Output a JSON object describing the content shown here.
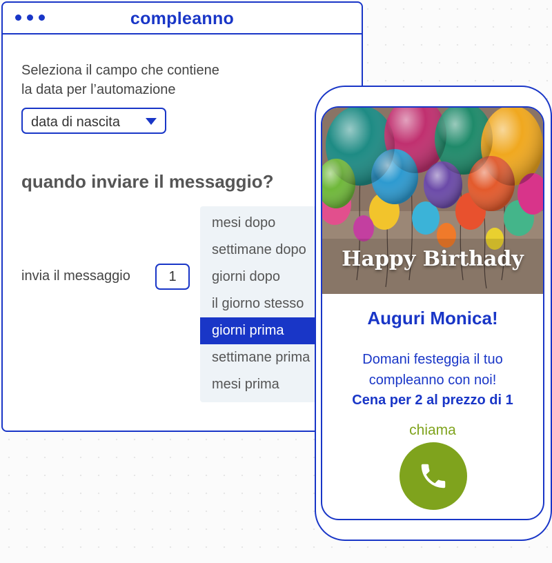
{
  "window": {
    "title": "compleanno",
    "dots": [
      "dot",
      "dot",
      "dot"
    ]
  },
  "form": {
    "instruction_line1": "Seleziona il campo che contiene",
    "instruction_line2": "la data per l’automazione",
    "field_select_value": "data di nascita",
    "question": "quando inviare il messaggio?",
    "send_label": "invia il messaggio",
    "quantity_value": "1",
    "timing_options": [
      "mesi dopo",
      "settimane dopo",
      "giorni dopo",
      "il giorno stesso",
      "giorni prima",
      "settimane prima",
      "mesi prima"
    ],
    "selected_option": "giorni prima"
  },
  "phone": {
    "hero_text": "Happy Birthady",
    "greeting": "Auguri Monica!",
    "message_line1": "Domani festeggia il tuo",
    "message_line2": "compleanno con noi!",
    "offer": "Cena per 2 al prezzo di 1",
    "call_label": "chiama",
    "call_icon": "phone-icon"
  },
  "colors": {
    "brand_blue": "#1936c7",
    "call_green": "#7fa31d",
    "menu_background": "#eef3f7"
  }
}
